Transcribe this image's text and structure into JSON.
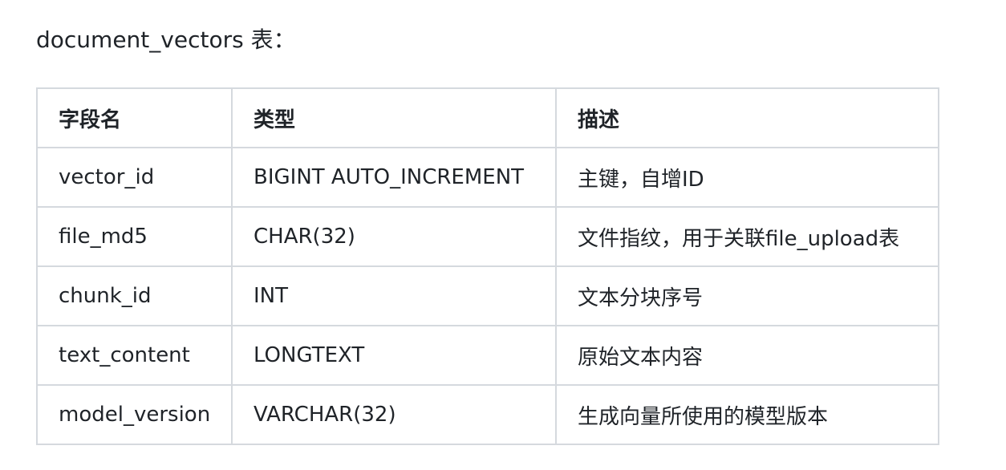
{
  "document": {
    "heading": "document_vectors 表："
  },
  "table": {
    "headers": [
      "字段名",
      "类型",
      "描述"
    ],
    "rows": [
      [
        "vector_id",
        "BIGINT AUTO_INCREMENT",
        "主键，自增ID"
      ],
      [
        "file_md5",
        "CHAR(32)",
        "文件指纹，用于关联file_upload表"
      ],
      [
        "chunk_id",
        "INT",
        "文本分块序号"
      ],
      [
        "text_content",
        "LONGTEXT",
        "原始文本内容"
      ],
      [
        "model_version",
        "VARCHAR(32)",
        "生成向量所使用的模型版本"
      ]
    ]
  }
}
